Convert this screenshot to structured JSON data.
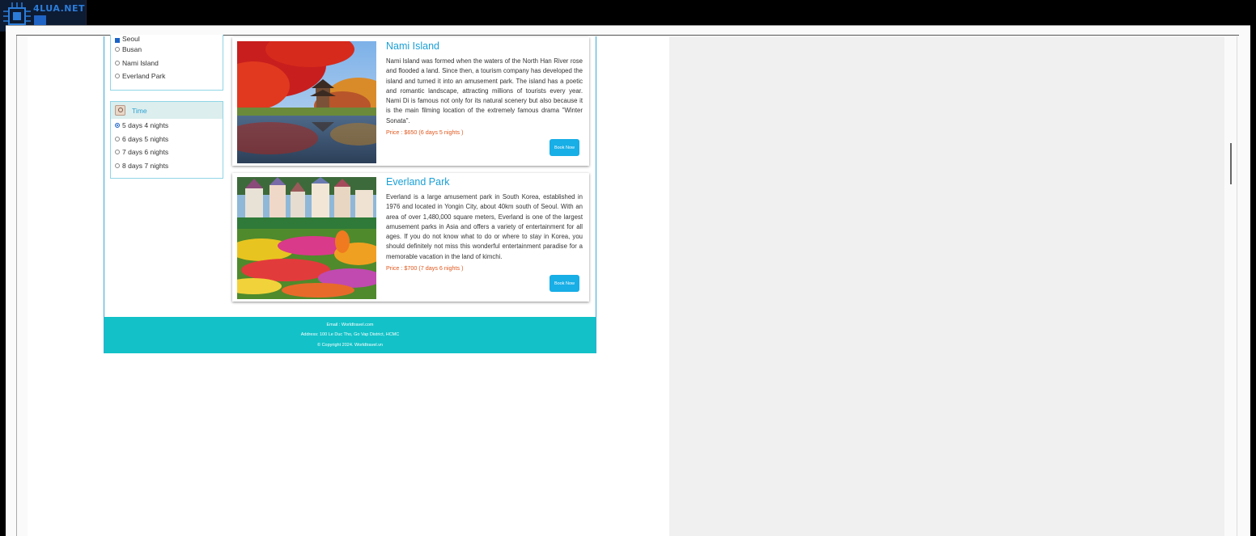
{
  "watermark": {
    "text": "4LUA.NET",
    "icon": "chip-logo-icon"
  },
  "location_filter": {
    "options": [
      {
        "label": "Seoul",
        "checked": true
      },
      {
        "label": "Busan",
        "checked": false
      },
      {
        "label": "Nami Island",
        "checked": false
      },
      {
        "label": "Everland Park",
        "checked": false
      }
    ]
  },
  "time_filter": {
    "title": "Time",
    "icon": "clock-icon",
    "options": [
      {
        "label": "5 days 4 nights",
        "selected": true
      },
      {
        "label": "6 days 5 nights",
        "selected": false
      },
      {
        "label": "7 days 6 nights",
        "selected": false
      },
      {
        "label": "8 days 7 nights",
        "selected": false
      }
    ]
  },
  "tours": [
    {
      "title": "Nami Island",
      "description": "Nami Island was formed when the waters of the North Han River rose and flooded a land. Since then, a tourism company has developed the island and turned it into an amusement park. The island has a poetic and romantic landscape, attracting millions of tourists every year. Nami Di is famous not only for its natural scenery but also because it is the main filming location of the extremely famous drama \"Winter Sonata\".",
      "price": "Price : $650 (6 days 5 nights )",
      "button": "Book Now"
    },
    {
      "title": "Everland Park",
      "description": "Everland is a large amusement park in South Korea, established in 1976 and located in Yongin City, about 40km south of Seoul. With an area of over 1,480,000 square meters, Everland is one of the largest amusement parks in Asia and offers a variety of entertainment for all ages. If you do not know what to do or where to stay in Korea, you should definitely not miss this wonderful entertainment paradise for a memorable vacation in the land of kimchi.",
      "price": "Price : $700 (7 days 6 nights )",
      "button": "Book Now"
    }
  ],
  "footer": {
    "email": "Email : Worldtravel.com",
    "address": "Address: 100 Le Duc Tho, Go Vap District, HCMC",
    "copyright": "© Copyright 2024. Worldtravel.vn"
  },
  "colors": {
    "accent": "#18aee6",
    "footer": "#12c2c8",
    "price": "#e0561c"
  }
}
